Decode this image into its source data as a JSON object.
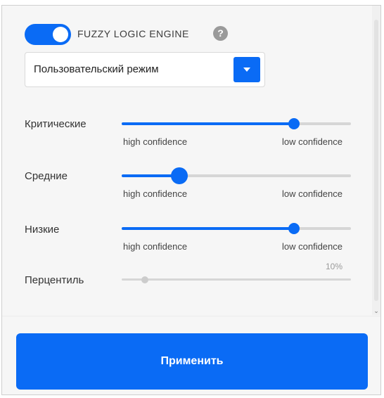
{
  "engine": {
    "enabled": true,
    "label": "FUZZY LOGIC ENGINE",
    "help_glyph": "?"
  },
  "mode_select": {
    "selected": "Пользовательский режим"
  },
  "sliders": [
    {
      "label": "Критические",
      "left_text": "high confidence",
      "right_text": "low confidence",
      "value": 0.75
    },
    {
      "label": "Средние",
      "left_text": "high confidence",
      "right_text": "low confidence",
      "value": 0.25
    },
    {
      "label": "Низкие",
      "left_text": "high confidence",
      "right_text": "low confidence",
      "value": 0.75
    }
  ],
  "percentile": {
    "label": "Перцентиль",
    "value_text": "10%",
    "value": 0.1
  },
  "apply_label": "Применить",
  "colors": {
    "accent": "#0a6bf5",
    "track": "#d6d6d6",
    "disabled": "#cccccc"
  }
}
